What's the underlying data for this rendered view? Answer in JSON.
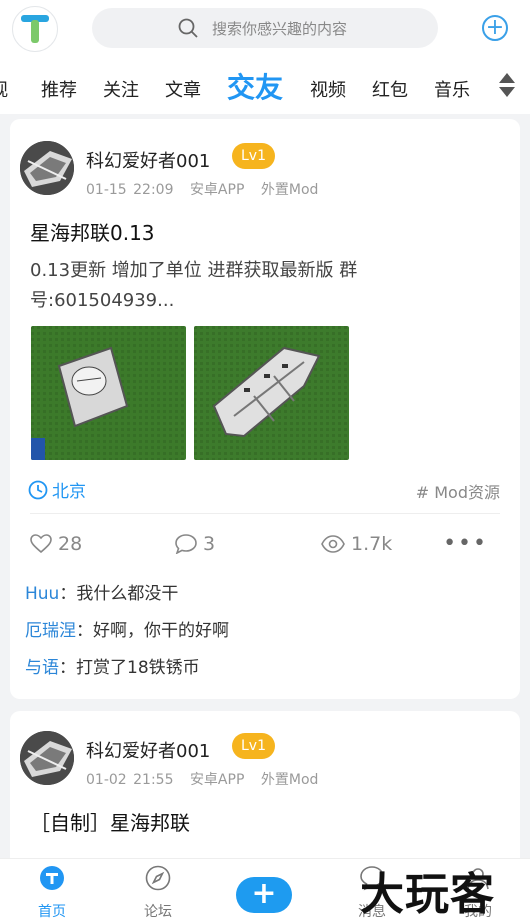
{
  "header": {
    "search_placeholder": "搜索你感兴趣的内容"
  },
  "tabs": [
    "观",
    "推荐",
    "关注",
    "文章",
    "交友",
    "视频",
    "红包",
    "音乐"
  ],
  "active_tab": "交友",
  "posts": [
    {
      "author": "科幻爱好者001",
      "level": "Lv1",
      "time": "01-15 22:09",
      "platform": "安卓APP",
      "category": "外置Mod",
      "title": "星海邦联0.13",
      "body": "0.13更新 增加了单位 进群获取最新版 群号:601504939...",
      "location": "北京",
      "tag": "# Mod资源",
      "likes": "28",
      "comments_count": "3",
      "views": "1.7k",
      "comments": [
        {
          "user": "Huu",
          "text": "：我什么都没干"
        },
        {
          "user": "厄瑞涅",
          "text": "：好啊，你干的好啊"
        },
        {
          "user": "与语",
          "text": "：打赏了18铁锈币"
        }
      ]
    },
    {
      "author": "科幻爱好者001",
      "level": "Lv1",
      "time": "01-02 21:55",
      "platform": "安卓APP",
      "category": "外置Mod",
      "title": "［自制］星海邦联"
    }
  ],
  "bottom_nav": {
    "home": "首页",
    "forum": "论坛",
    "messages": "消息",
    "mine": "我的"
  },
  "watermark": "大玩客",
  "colors": {
    "accent": "#2196f3",
    "level_badge": "#f6b41e"
  }
}
